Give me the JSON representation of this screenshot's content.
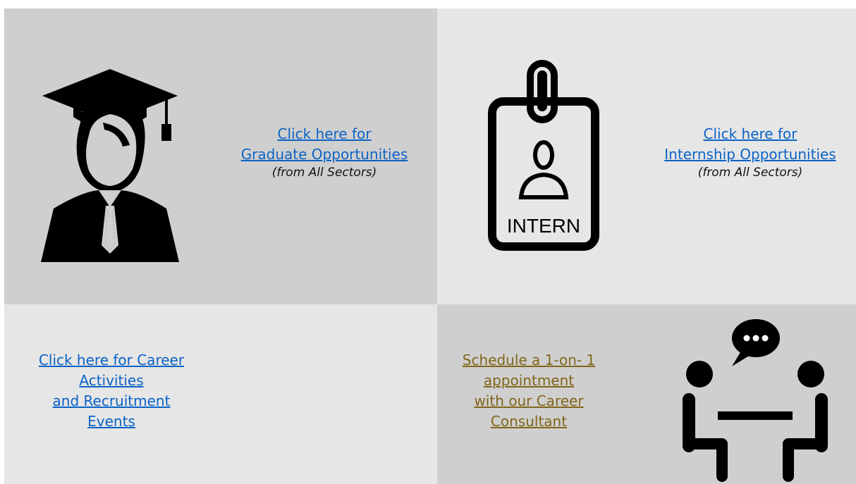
{
  "tiles": {
    "graduate": {
      "icon": "graduate-icon",
      "link_line1": "Click here for",
      "link_line2": "Graduate Opportunities",
      "note": "(from All Sectors)",
      "background": "#d0cfcf"
    },
    "internship": {
      "icon": "intern-badge-icon",
      "badge_text": "INTERN",
      "link_line1": "Click here for",
      "link_line2": "Internship Opportunities",
      "note": "(from All Sectors)",
      "background": "#e6e6e6"
    },
    "events": {
      "link_lines": [
        "Click here for Career",
        "Activities",
        "and Recruitment",
        "Events"
      ],
      "background": "#e6e6e6"
    },
    "consultation": {
      "icon": "consultation-meeting-icon",
      "link_lines": [
        "Schedule a 1-on- 1",
        "appointment",
        "with our Career",
        "Consultant"
      ],
      "background": "#d0cfcf"
    }
  },
  "colors": {
    "link_blue": "#0b63c5",
    "link_gold": "#80661a"
  }
}
